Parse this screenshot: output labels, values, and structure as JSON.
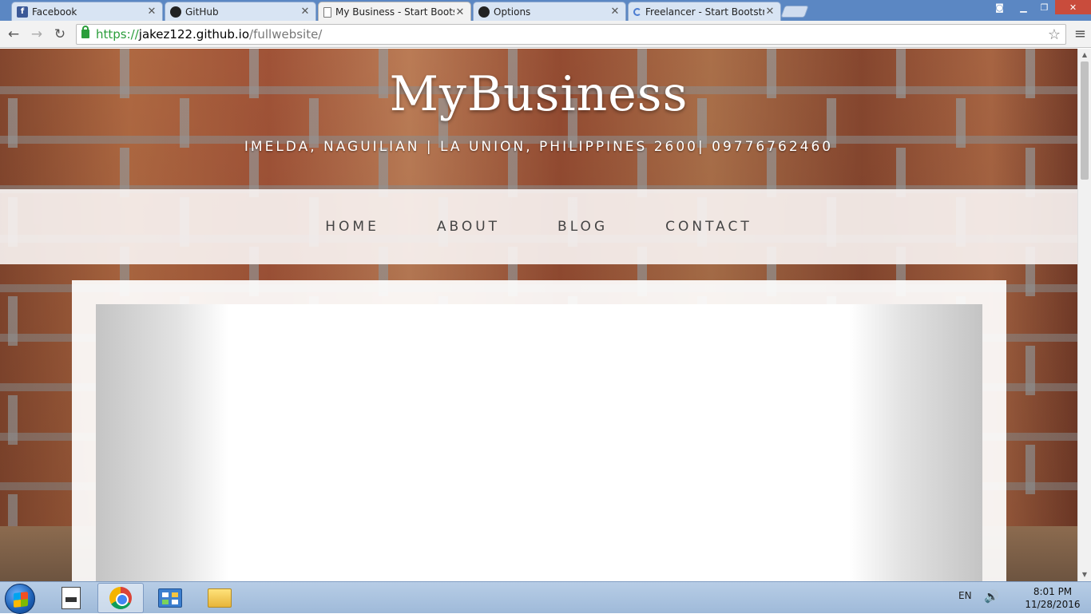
{
  "browser": {
    "tabs": [
      {
        "title": "Facebook",
        "favicon": "facebook-icon",
        "active": false
      },
      {
        "title": "GitHub",
        "favicon": "github-icon",
        "active": false
      },
      {
        "title": "My Business - Start Bootst",
        "favicon": "document-icon",
        "active": true
      },
      {
        "title": "Options",
        "favicon": "github-icon",
        "active": false
      },
      {
        "title": "Freelancer - Start Bootstra",
        "favicon": "loading-icon",
        "active": false
      }
    ],
    "url": {
      "scheme": "https://",
      "host": "jakez122.github.io",
      "path": "/fullwebsite/"
    },
    "close_glyph": "✕",
    "back_glyph": "←",
    "forward_glyph": "→",
    "reload_glyph": "↻",
    "star_glyph": "☆",
    "menu_glyph": "≡"
  },
  "site": {
    "brand": "MyBusiness",
    "address": "IMELDA, NAGUILIAN | LA UNION, PHILIPPINES 2600| 09776762460",
    "nav": [
      "HOME",
      "ABOUT",
      "BLOG",
      "CONTACT"
    ]
  },
  "taskbar": {
    "language": "EN",
    "volume_glyph": "🔊",
    "time": "8:01 PM",
    "date": "11/28/2016"
  }
}
